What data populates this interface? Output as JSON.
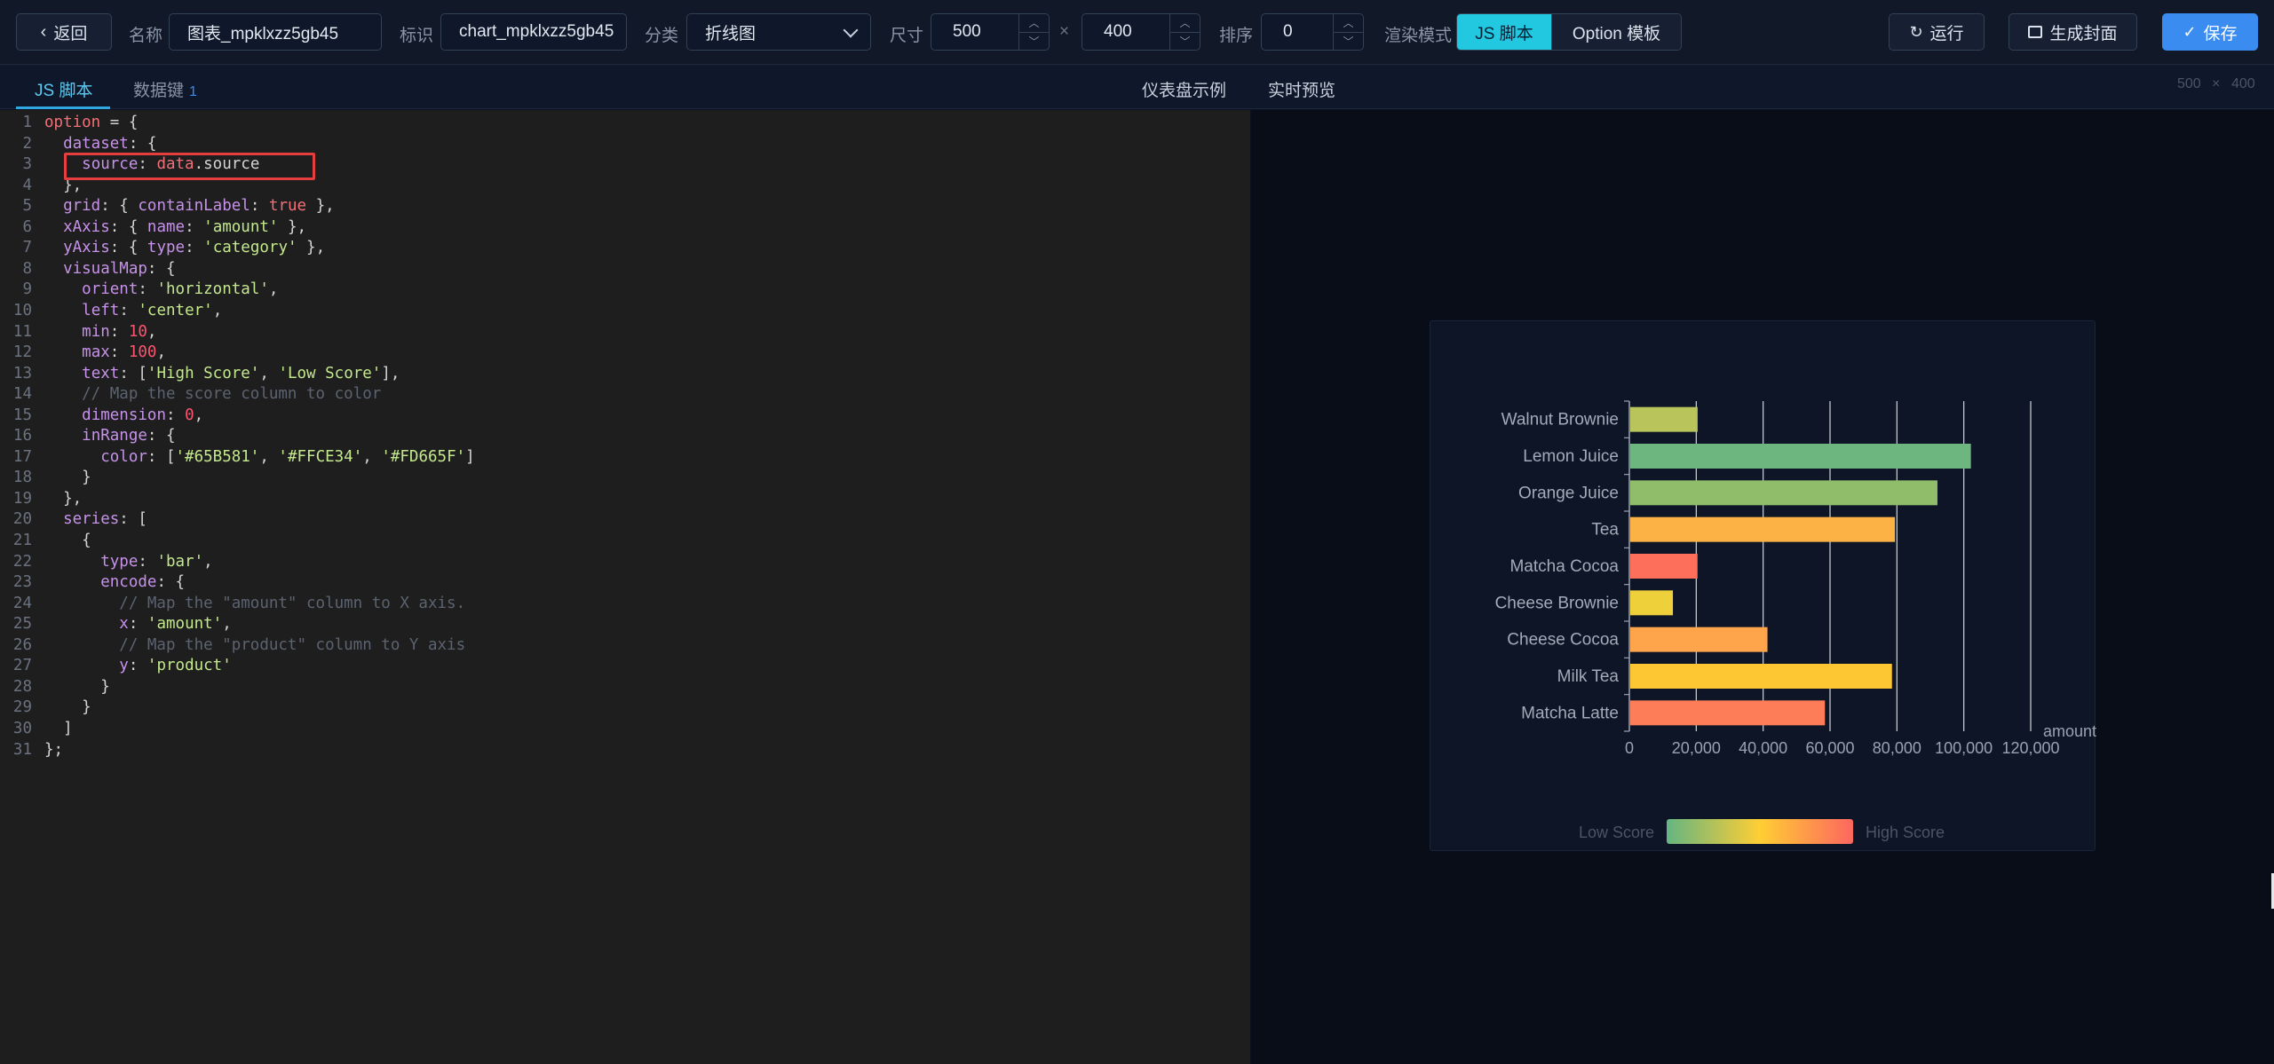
{
  "toolbar": {
    "back_label": "返回",
    "name_label": "名称",
    "name_value": "图表_mpklxzz5gb45",
    "id_label": "标识",
    "id_value": "chart_mpklxzz5gb45",
    "category_label": "分类",
    "category_value": "折线图",
    "size_label": "尺寸",
    "width_value": "500",
    "times": "×",
    "height_value": "400",
    "order_label": "排序",
    "order_value": "0",
    "render_mode_label": "渲染模式",
    "mode_js": "JS 脚本",
    "mode_option": "Option 模板",
    "run_label": "运行",
    "cover_label": "生成封面",
    "save_label": "保存"
  },
  "tabs": {
    "js_script": "JS 脚本",
    "data_keys": "数据键",
    "data_keys_count": "1",
    "dashboard_example": "仪表盘示例",
    "live_preview": "实时预览",
    "size_hint_w": "500",
    "size_hint_x": "×",
    "size_hint_h": "400"
  },
  "editor": {
    "lines": [
      "option = {",
      "  dataset: {",
      "    source: data.source",
      "  },",
      "  grid: { containLabel: true },",
      "  xAxis: { name: 'amount' },",
      "  yAxis: { type: 'category' },",
      "  visualMap: {",
      "    orient: 'horizontal',",
      "    left: 'center',",
      "    min: 10,",
      "    max: 100,",
      "    text: ['High Score', 'Low Score'],",
      "    // Map the score column to color",
      "    dimension: 0,",
      "    inRange: {",
      "      color: ['#65B581', '#FFCE34', '#FD665F']",
      "    }",
      "  },",
      "  series: [",
      "    {",
      "      type: 'bar',",
      "      encode: {",
      "        // Map the \"amount\" column to X axis.",
      "        x: 'amount',",
      "        // Map the \"product\" column to Y axis",
      "        y: 'product'",
      "      }",
      "    }",
      "  ]",
      "};"
    ]
  },
  "chart_data": {
    "type": "bar",
    "orientation": "horizontal",
    "categories": [
      "Walnut Brownie",
      "Lemon Juice",
      "Orange Juice",
      "Tea",
      "Matcha Cocoa",
      "Cheese Brownie",
      "Cheese Cocoa",
      "Milk Tea",
      "Matcha Latte"
    ],
    "values": [
      20145,
      101852,
      91852,
      79146,
      20112,
      12755,
      41032,
      78254,
      58212
    ],
    "colors": [
      "#b9c45b",
      "#6db67f",
      "#8fbd6a",
      "#fdb246",
      "#fd6f5a",
      "#eed03a",
      "#fea54b",
      "#fdc733",
      "#fd7d59"
    ],
    "xlabel": "amount",
    "xticks": [
      "0",
      "20,000",
      "40,000",
      "60,000",
      "80,000",
      "100,000",
      "120,000"
    ],
    "xlim": [
      0,
      120000
    ],
    "grid": true,
    "visual_map": {
      "low_text": "Low Score",
      "high_text": "High Score",
      "colors": [
        "#65B581",
        "#FFCE34",
        "#FD665F"
      ]
    }
  }
}
